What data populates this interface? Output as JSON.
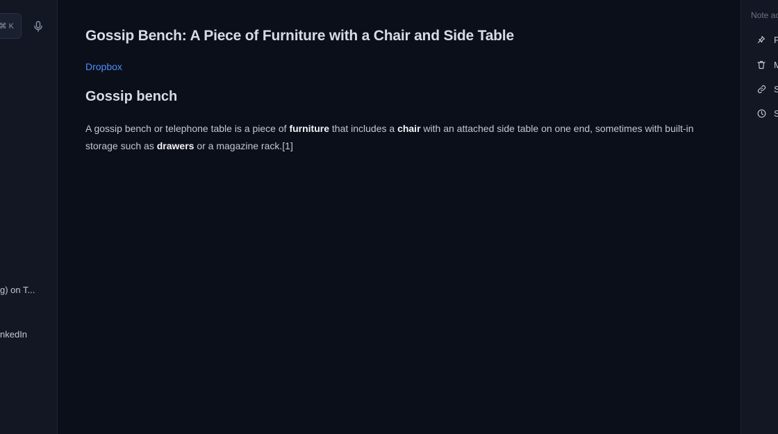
{
  "sidebar": {
    "shortcut_hint": "⌘ K",
    "items": [
      {
        "label": "g) on T..."
      },
      {
        "label": "nkedIn"
      }
    ]
  },
  "note": {
    "title": "Gossip Bench: A Piece of Furniture with a Chair and Side Table",
    "source_link": "Dropbox",
    "section_heading": "Gossip bench",
    "body": {
      "t1": "A gossip bench or telephone table is a piece of ",
      "b1": "furniture",
      "t2": " that includes a ",
      "b2": "chair",
      "t3": " with an attached side table on one end, sometimes with built-in storage such as ",
      "b3": "drawers",
      "t4": " or a magazine rack.[1]"
    }
  },
  "right_panel": {
    "heading": "Note ac",
    "actions": [
      {
        "label": "P",
        "icon": "pin-icon"
      },
      {
        "label": "M",
        "icon": "trash-icon"
      },
      {
        "label": "S",
        "icon": "link-icon"
      },
      {
        "label": "S",
        "icon": "clock-icon"
      }
    ]
  },
  "colors": {
    "background": "#0b0f1a",
    "panel": "#121723",
    "link": "#4f8ef7"
  }
}
